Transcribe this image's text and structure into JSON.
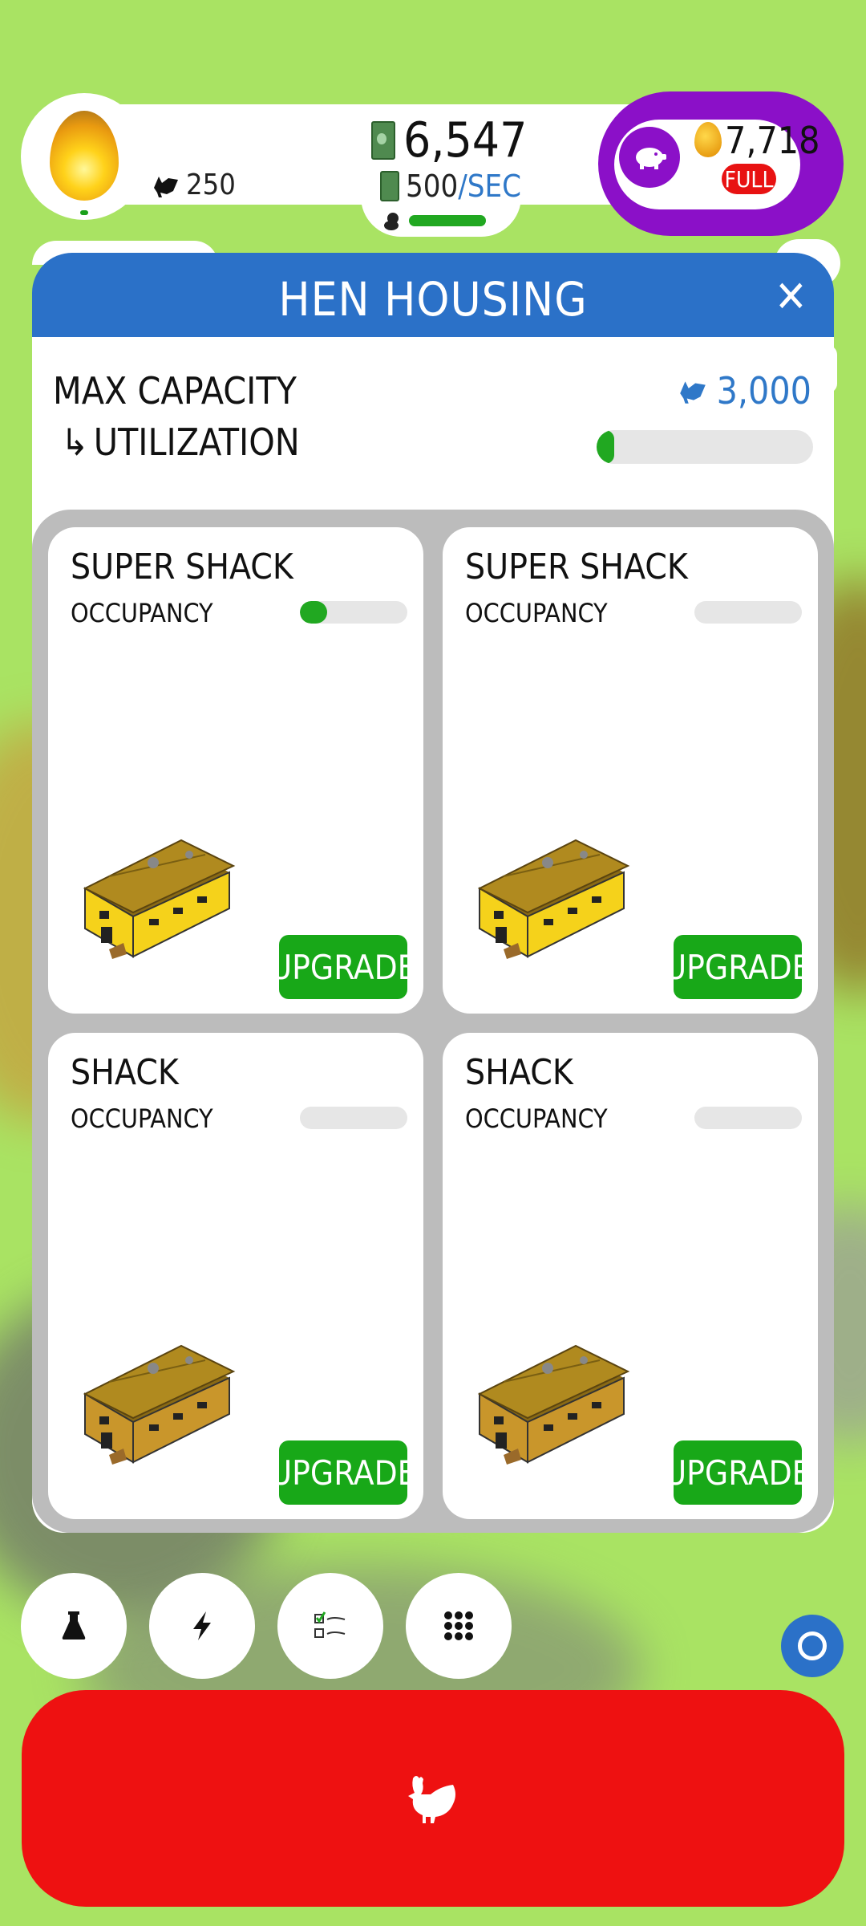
{
  "colors": {
    "background": "#a9e363",
    "header_blue": "#2b71c8",
    "accent_green": "#21a821",
    "piggy_purple": "#8b10c8",
    "hatch_red": "#ee1111",
    "link_blue": "#2f78c8"
  },
  "stats": {
    "hens": "250",
    "money": "6,547",
    "rate_value": "500",
    "rate_unit": "/SEC",
    "golden_eggs": "7,718",
    "piggy_status": "FULL",
    "chicks_progress": 1.0
  },
  "panel": {
    "title": "HEN HOUSING",
    "close_glyph": "✕",
    "max_capacity_label": "MAX CAPACITY",
    "max_capacity_value": "3,000",
    "utilization_arrow": "↳",
    "utilization_label": "UTILIZATION",
    "utilization_fraction": 0.083
  },
  "houses": [
    {
      "name": "SUPER SHACK",
      "occupancy_label": "OCCUPANCY",
      "occupancy_fraction": 0.25,
      "upgrade_label": "UPGRADE",
      "style": "super"
    },
    {
      "name": "SUPER SHACK",
      "occupancy_label": "OCCUPANCY",
      "occupancy_fraction": 0.0,
      "upgrade_label": "UPGRADE",
      "style": "super"
    },
    {
      "name": "SHACK",
      "occupancy_label": "OCCUPANCY",
      "occupancy_fraction": 0.0,
      "upgrade_label": "UPGRADE",
      "style": "shack"
    },
    {
      "name": "SHACK",
      "occupancy_label": "OCCUPANCY",
      "occupancy_fraction": 0.0,
      "upgrade_label": "UPGRADE",
      "style": "shack"
    }
  ],
  "bottom_buttons": [
    {
      "icon": "flask-icon"
    },
    {
      "icon": "lightning-icon"
    },
    {
      "icon": "checklist-icon"
    },
    {
      "icon": "grid-menu-icon"
    }
  ]
}
